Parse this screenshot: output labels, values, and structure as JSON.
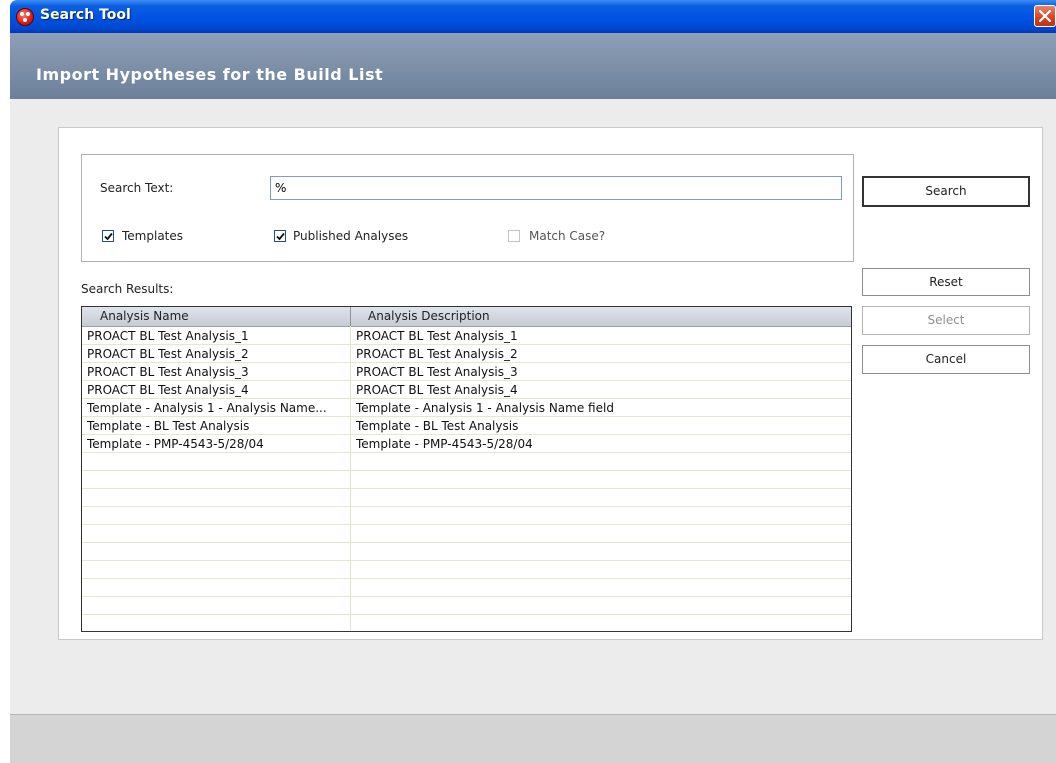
{
  "window": {
    "title": "Search Tool"
  },
  "header": {
    "title": "Import Hypotheses for the Build List"
  },
  "search": {
    "label": "Search Text:",
    "value": "%",
    "templates_label": "Templates",
    "templates_checked": true,
    "published_label": "Published Analyses",
    "published_checked": true,
    "match_case_label": "Match Case?",
    "match_case_checked": false
  },
  "buttons": {
    "search": "Search",
    "reset": "Reset",
    "select": "Select",
    "cancel": "Cancel"
  },
  "results": {
    "label": "Search Results:",
    "columns": [
      "Analysis Name",
      "Analysis Description"
    ],
    "rows": [
      [
        "PROACT BL Test Analysis_1",
        "PROACT BL Test Analysis_1"
      ],
      [
        "PROACT BL Test Analysis_2",
        "PROACT BL Test Analysis_2"
      ],
      [
        "PROACT BL Test Analysis_3",
        "PROACT BL Test Analysis_3"
      ],
      [
        "PROACT BL Test Analysis_4",
        "PROACT BL Test Analysis_4"
      ],
      [
        "Template - Analysis 1 - Analysis Name...",
        "Template - Analysis 1 - Analysis Name field"
      ],
      [
        "Template - BL Test Analysis",
        "Template - BL Test Analysis"
      ],
      [
        "Template - PMP-4543-5/28/04",
        "Template - PMP-4543-5/28/04"
      ]
    ]
  }
}
